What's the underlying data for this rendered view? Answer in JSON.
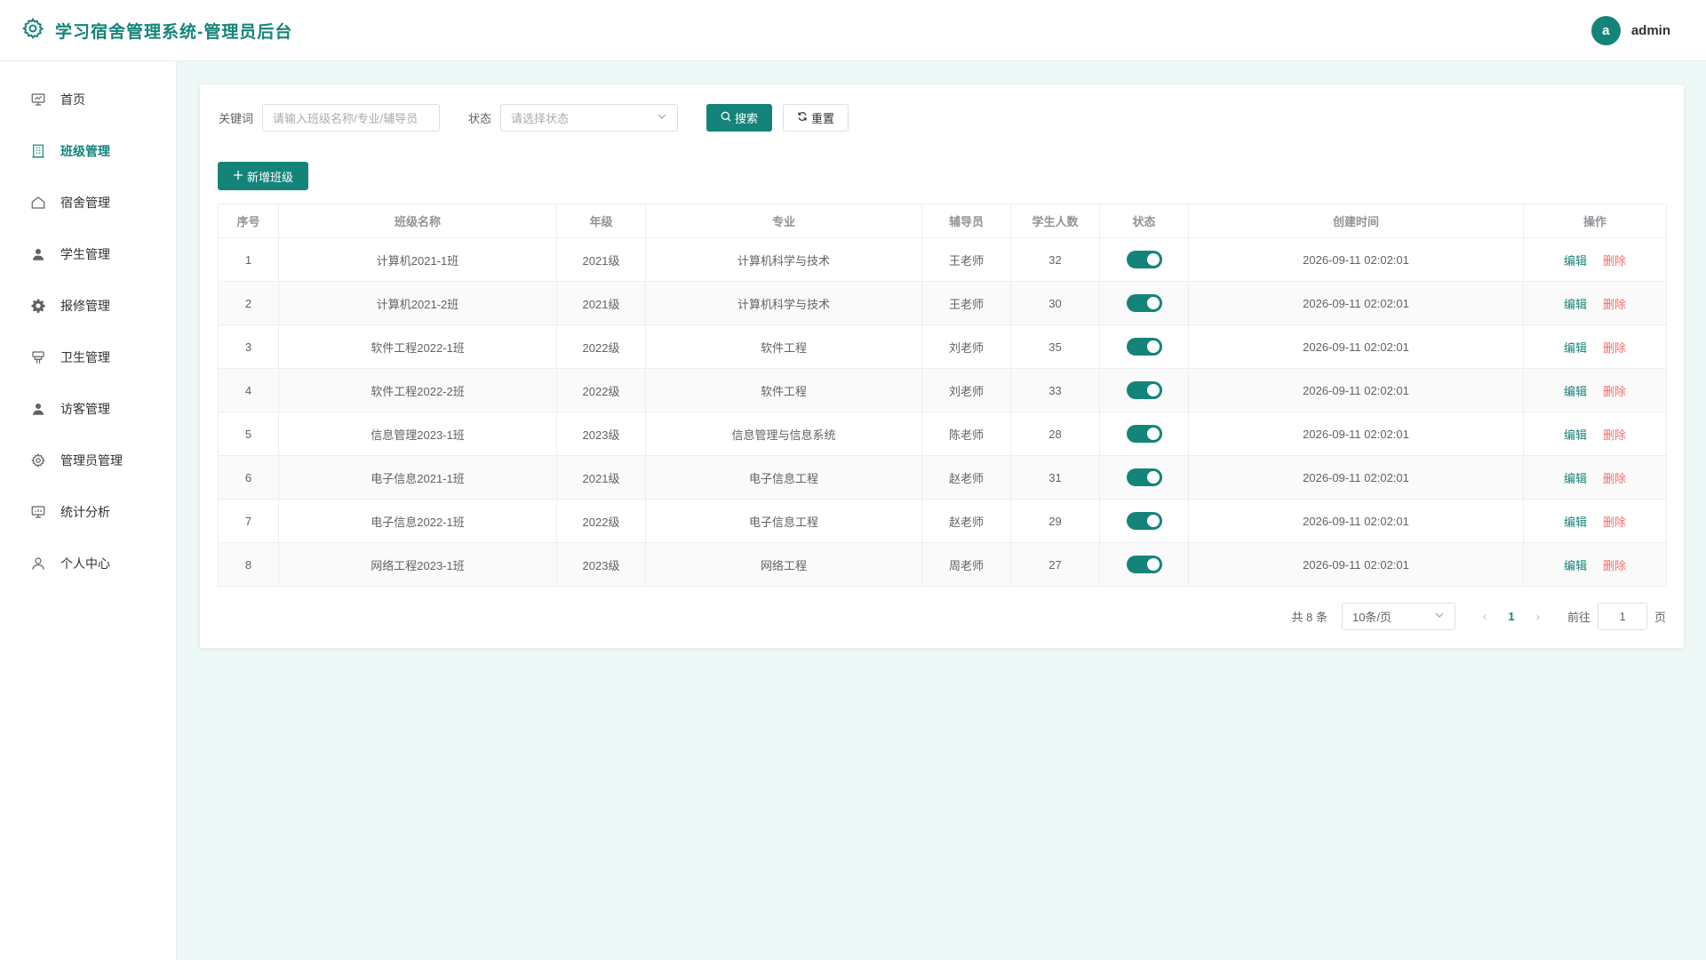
{
  "header": {
    "title": "学习宿舍管理系统-管理员后台",
    "avatar_letter": "a",
    "username": "admin"
  },
  "sidebar": {
    "items": [
      {
        "label": "首页",
        "icon": "dashboard-icon"
      },
      {
        "label": "班级管理",
        "icon": "building-icon",
        "active": true
      },
      {
        "label": "宿舍管理",
        "icon": "house-icon"
      },
      {
        "label": "学生管理",
        "icon": "user-icon"
      },
      {
        "label": "报修管理",
        "icon": "gear-icon"
      },
      {
        "label": "卫生管理",
        "icon": "brush-icon"
      },
      {
        "label": "访客管理",
        "icon": "user-icon"
      },
      {
        "label": "管理员管理",
        "icon": "settings-icon"
      },
      {
        "label": "统计分析",
        "icon": "chart-icon"
      },
      {
        "label": "个人中心",
        "icon": "user-outline-icon"
      }
    ]
  },
  "filter": {
    "keyword_label": "关键词",
    "keyword_placeholder": "请输入班级名称/专业/辅导员",
    "status_label": "状态",
    "status_placeholder": "请选择状态",
    "search_label": "搜索",
    "reset_label": "重置"
  },
  "add_label": "新增班级",
  "table": {
    "columns": [
      "序号",
      "班级名称",
      "年级",
      "专业",
      "辅导员",
      "学生人数",
      "状态",
      "创建时间",
      "操作"
    ],
    "rows": [
      {
        "no": "1",
        "name": "计算机2021-1班",
        "grade": "2021级",
        "major": "计算机科学与技术",
        "counselor": "王老师",
        "count": "32",
        "status": true,
        "created": "2026-09-11 02:02:01"
      },
      {
        "no": "2",
        "name": "计算机2021-2班",
        "grade": "2021级",
        "major": "计算机科学与技术",
        "counselor": "王老师",
        "count": "30",
        "status": true,
        "created": "2026-09-11 02:02:01"
      },
      {
        "no": "3",
        "name": "软件工程2022-1班",
        "grade": "2022级",
        "major": "软件工程",
        "counselor": "刘老师",
        "count": "35",
        "status": true,
        "created": "2026-09-11 02:02:01"
      },
      {
        "no": "4",
        "name": "软件工程2022-2班",
        "grade": "2022级",
        "major": "软件工程",
        "counselor": "刘老师",
        "count": "33",
        "status": true,
        "created": "2026-09-11 02:02:01"
      },
      {
        "no": "5",
        "name": "信息管理2023-1班",
        "grade": "2023级",
        "major": "信息管理与信息系统",
        "counselor": "陈老师",
        "count": "28",
        "status": true,
        "created": "2026-09-11 02:02:01"
      },
      {
        "no": "6",
        "name": "电子信息2021-1班",
        "grade": "2021级",
        "major": "电子信息工程",
        "counselor": "赵老师",
        "count": "31",
        "status": true,
        "created": "2026-09-11 02:02:01"
      },
      {
        "no": "7",
        "name": "电子信息2022-1班",
        "grade": "2022级",
        "major": "电子信息工程",
        "counselor": "赵老师",
        "count": "29",
        "status": true,
        "created": "2026-09-11 02:02:01"
      },
      {
        "no": "8",
        "name": "网络工程2023-1班",
        "grade": "2023级",
        "major": "网络工程",
        "counselor": "周老师",
        "count": "27",
        "status": true,
        "created": "2026-09-11 02:02:01"
      }
    ],
    "edit_label": "编辑",
    "delete_label": "删除"
  },
  "pagination": {
    "total_text": "共 8 条",
    "page_size": "10条/页",
    "current_page": "1",
    "goto_label": "前往",
    "goto_value": "1",
    "page_suffix": "页"
  },
  "colors": {
    "primary": "#14847a",
    "danger": "#f56c6c"
  }
}
